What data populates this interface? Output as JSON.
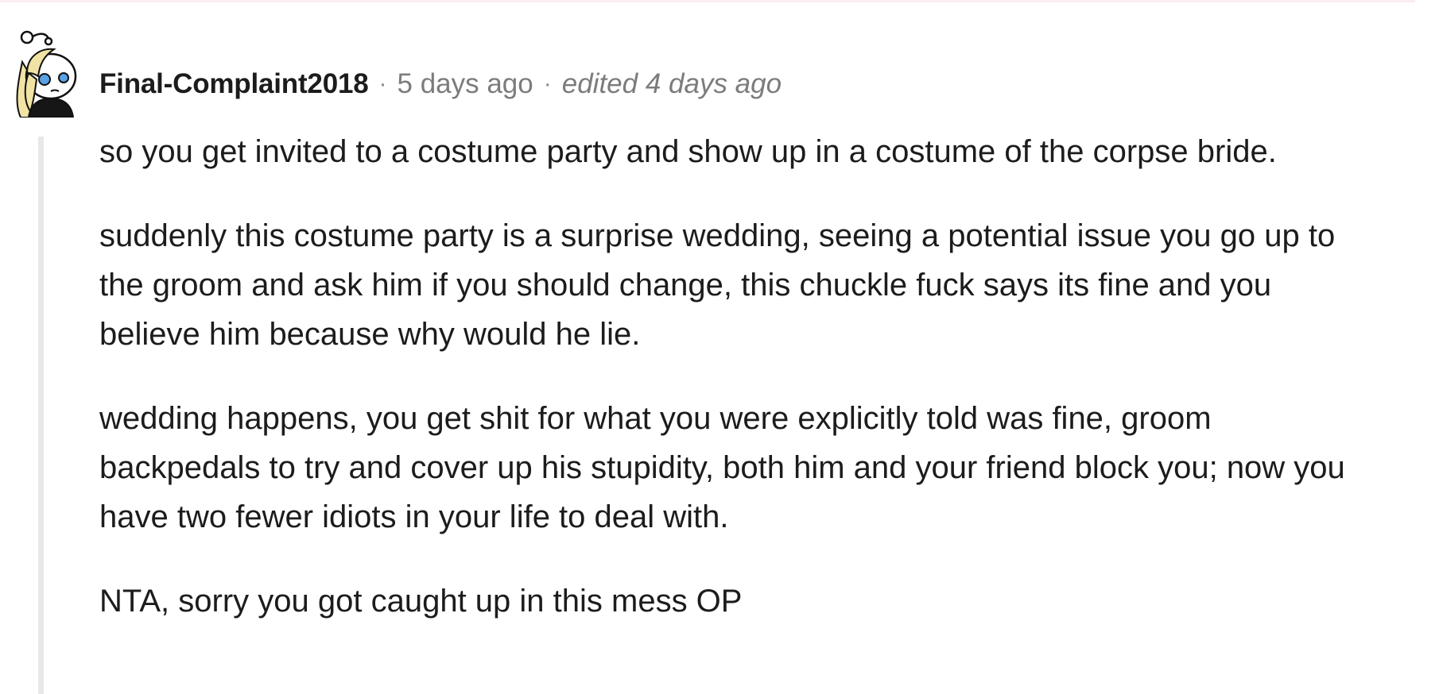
{
  "comment": {
    "author": "Final-Complaint2018",
    "separator": "·",
    "posted": "5 days ago",
    "edited": "edited 4 days ago",
    "paragraphs": [
      "so you get invited to a costume party and show up in a costume of the corpse bride.",
      "suddenly this costume party is a surprise wedding, seeing a potential issue you go up to the groom and ask him if you should change, this chuckle fuck says its fine and you believe him because why would he lie.",
      "wedding happens, you get shit for what you were explicitly told was fine, groom backpedals to try and cover up his stupidity, both him and your friend block you; now you have two fewer idiots in your life to deal with.",
      "NTA, sorry you got caught up in this mess OP"
    ]
  },
  "icons": {
    "avatar": "user-avatar-icon"
  },
  "colors": {
    "text": "#1c1c1c",
    "meta": "#7c7c7c",
    "thread_line": "#e8e8e8"
  }
}
